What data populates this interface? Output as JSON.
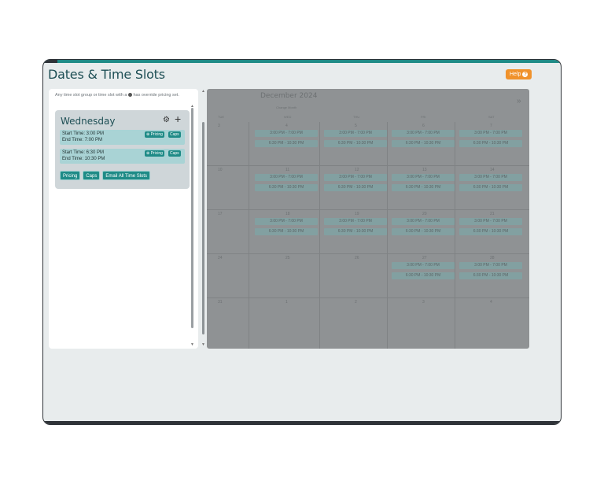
{
  "page": {
    "title": "Dates & Time Slots",
    "help_label": "Help"
  },
  "left": {
    "hint": "Any time slot group or time slot with a",
    "hint_suffix": "has override pricing set.",
    "day": {
      "title": "Wednesday",
      "slots": [
        {
          "start": "Start Time: 3:00 PM",
          "end": "End Time: 7:00 PM",
          "pricing": "Pricing",
          "caps": "Caps"
        },
        {
          "start": "Start Time: 6:30 PM",
          "end": "End Time: 10:30 PM",
          "pricing": "Pricing",
          "caps": "Caps"
        }
      ],
      "buttons": {
        "pricing": "Pricing",
        "caps": "Caps",
        "email": "Email All Time Slots"
      }
    }
  },
  "calendar": {
    "month": "December 2024",
    "change_month": "Change Month",
    "next": "»",
    "dow": [
      "TUE",
      "WED",
      "THU",
      "FRI",
      "SAT"
    ],
    "weeks": [
      [
        "3",
        "4",
        "5",
        "6",
        "7"
      ],
      [
        "10",
        "11",
        "12",
        "13",
        "14"
      ],
      [
        "17",
        "18",
        "19",
        "20",
        "21"
      ],
      [
        "24",
        "25",
        "26",
        "27",
        "28"
      ],
      [
        "31",
        "1",
        "2",
        "3",
        "4"
      ]
    ],
    "slot_labels": [
      "3:00 PM - 7:00 PM",
      "6:30 PM - 10:30 PM"
    ]
  },
  "colors": {
    "accent": "#1f8b87",
    "help": "#f0922c",
    "title": "#1e4f55"
  }
}
